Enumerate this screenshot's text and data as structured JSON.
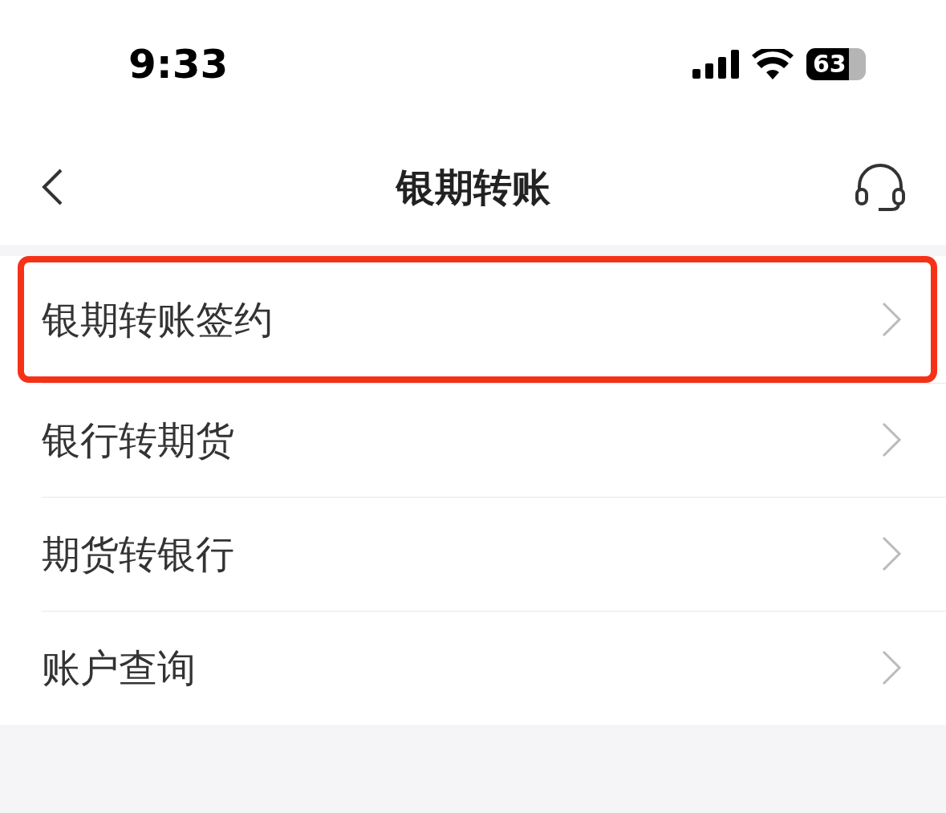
{
  "status_bar": {
    "time": "9:33",
    "battery": "63"
  },
  "nav": {
    "title": "银期转账"
  },
  "items": [
    {
      "label": "银期转账签约",
      "highlighted": true
    },
    {
      "label": "银行转期货",
      "highlighted": false
    },
    {
      "label": "期货转银行",
      "highlighted": false
    },
    {
      "label": "账户查询",
      "highlighted": false
    }
  ]
}
